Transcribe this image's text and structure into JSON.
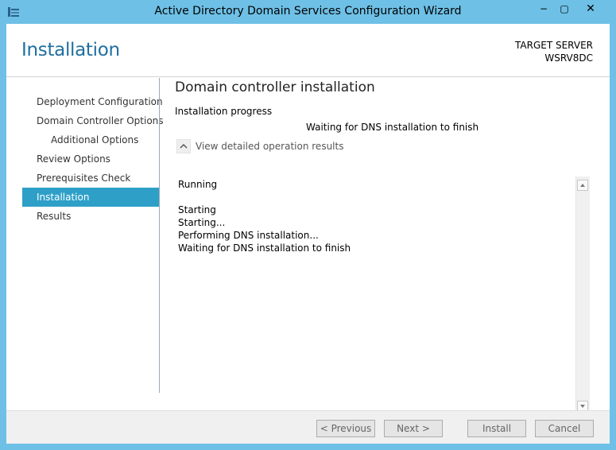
{
  "window": {
    "title": "Active Directory Domain Services Configuration Wizard",
    "controls": {
      "minimize": "−",
      "maximize": "▢",
      "close": "✕"
    }
  },
  "header": {
    "page_title": "Installation",
    "target_label": "TARGET SERVER",
    "target_server": "WSRV8DC"
  },
  "nav": {
    "items": [
      {
        "label": "Deployment Configuration"
      },
      {
        "label": "Domain Controller Options"
      },
      {
        "label": "Additional Options"
      },
      {
        "label": "Review Options"
      },
      {
        "label": "Prerequisites Check"
      },
      {
        "label": "Installation"
      },
      {
        "label": "Results"
      }
    ],
    "active": "Installation"
  },
  "main": {
    "title": "Domain controller installation",
    "progress_label": "Installation progress",
    "status": "Waiting for DNS installation to finish",
    "details_toggle": "View detailed operation results",
    "results": {
      "line1": "Running",
      "line2": "Starting",
      "line3": "Starting...",
      "line4": "Performing DNS installation...",
      "line5": "Waiting for DNS installation to finish"
    }
  },
  "footer": {
    "previous": "< Previous",
    "next": "Next >",
    "install": "Install",
    "cancel": "Cancel"
  },
  "colors": {
    "accent": "#2ea0c8",
    "title_blue": "#1e6fa1",
    "frame": "#6ec0e6"
  },
  "icons": {
    "app": "server-manager-icon",
    "collapse": "chevron-up-icon",
    "scroll_up": "scroll-up-arrow",
    "scroll_down": "scroll-down-arrow"
  }
}
